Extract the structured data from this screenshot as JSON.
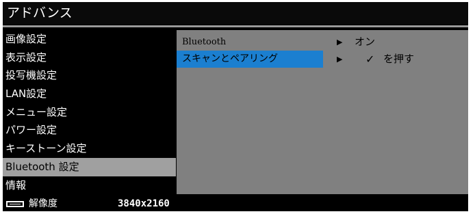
{
  "title": "アドバンス",
  "menu": {
    "items": [
      {
        "label": "画像設定"
      },
      {
        "label": "表示設定"
      },
      {
        "label": "投写機設定"
      },
      {
        "label": "LAN設定"
      },
      {
        "label": "メニュー設定"
      },
      {
        "label": "パワー設定"
      },
      {
        "label": "キーストーン設定"
      },
      {
        "label": "Bluetooth 設定"
      },
      {
        "label": "情報"
      }
    ],
    "selected_index": 7
  },
  "panel": {
    "rows": [
      {
        "label": "Bluetooth",
        "arrow": "▶",
        "value": "オン"
      },
      {
        "label": "スキャンとペアリング",
        "arrow": "▶",
        "check": "✓",
        "value": "を押す"
      }
    ],
    "highlighted_index": 1
  },
  "status": {
    "icon": "display-icon",
    "label": "解像度",
    "value": "3840x2160"
  },
  "colors": {
    "highlight": "#1b7fd0",
    "selected_menu": "#a0a0a0",
    "panel_bg": "#808080"
  }
}
